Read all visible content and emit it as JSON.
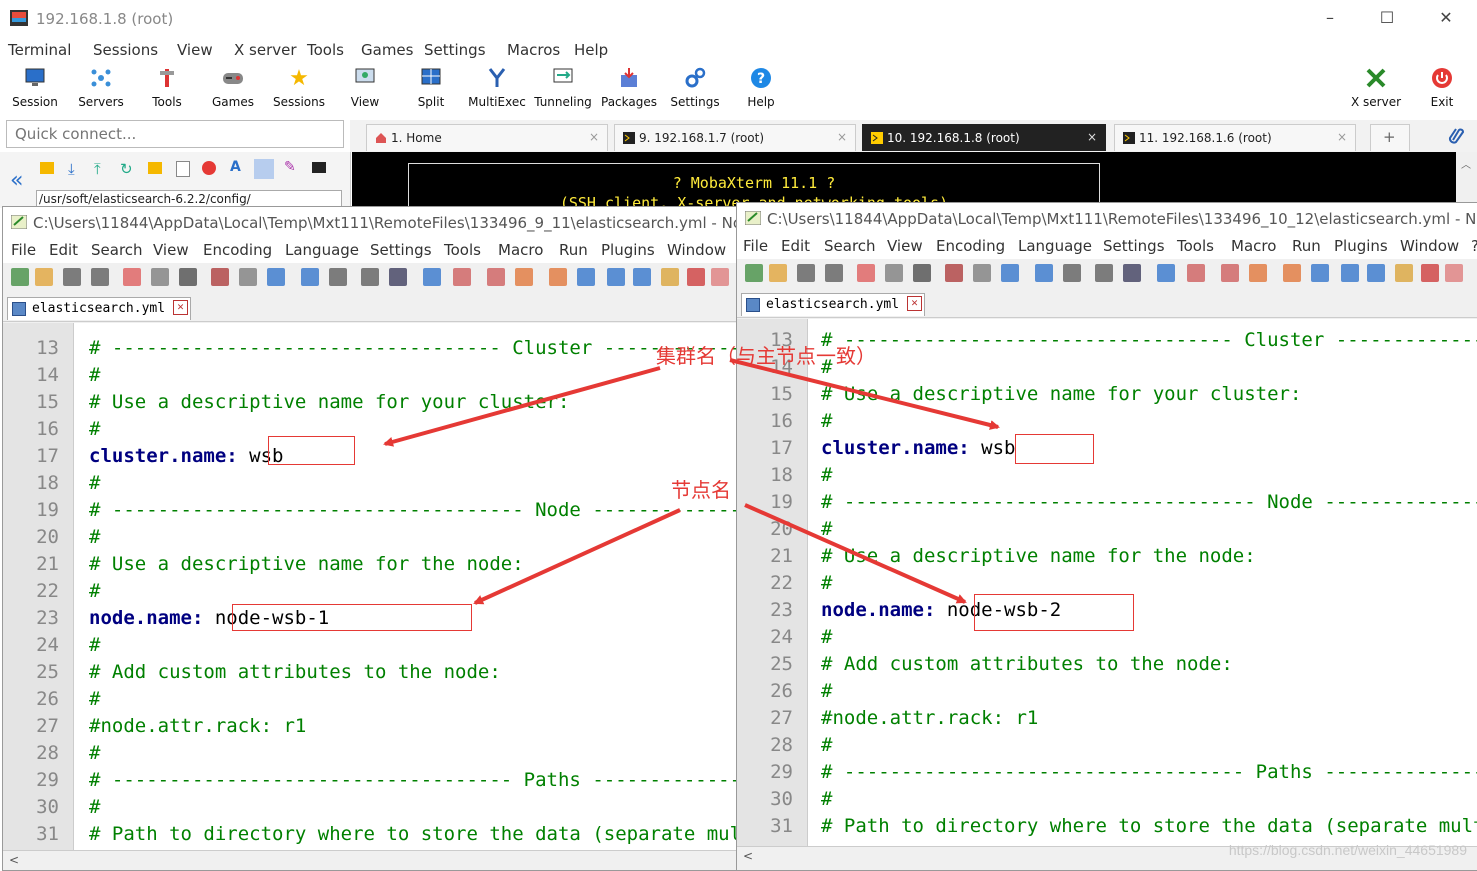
{
  "moba": {
    "title": "192.168.1.8 (root)",
    "menu": [
      "Terminal",
      "Sessions",
      "View",
      "X server",
      "Tools",
      "Games",
      "Settings",
      "Macros",
      "Help"
    ],
    "toolbar": [
      {
        "label": "Session",
        "icon": "monitor-icon"
      },
      {
        "label": "Servers",
        "icon": "servers-icon"
      },
      {
        "label": "Tools",
        "icon": "tools-icon"
      },
      {
        "label": "Games",
        "icon": "gamepad-icon"
      },
      {
        "label": "Sessions",
        "icon": "star-icon"
      },
      {
        "label": "View",
        "icon": "view-icon"
      },
      {
        "label": "Split",
        "icon": "split-icon"
      },
      {
        "label": "MultiExec",
        "icon": "fork-icon"
      },
      {
        "label": "Tunneling",
        "icon": "tunnel-icon"
      },
      {
        "label": "Packages",
        "icon": "package-icon"
      },
      {
        "label": "Settings",
        "icon": "gears-icon"
      },
      {
        "label": "Help",
        "icon": "help-icon"
      }
    ],
    "xserver_label": "X server",
    "exit_label": "Exit",
    "quick_connect_placeholder": "Quick connect...",
    "tabs": [
      {
        "label": "1. Home",
        "close": "×"
      },
      {
        "label": "9. 192.168.1.7 (root)",
        "close": "×"
      },
      {
        "label": "10. 192.168.1.8 (root)",
        "close": "×"
      },
      {
        "label": "11. 192.168.1.6 (root)",
        "close": "×"
      }
    ],
    "sidebar_path": "/usr/soft/elasticsearch-6.2.2/config/",
    "terminal_banner": "? MobaXterm 11.1 ?",
    "terminal_banner2": "(SSH client, X-server and networking tools)"
  },
  "left": {
    "title": "C:\\Users\\11844\\AppData\\Local\\Temp\\Mxt111\\RemoteFiles\\133496_9_11\\elasticsearch.yml - Notepad++",
    "menu": [
      "File",
      "Edit",
      "Search",
      "View",
      "Encoding",
      "Language",
      "Settings",
      "Tools",
      "Macro",
      "Run",
      "Plugins",
      "Window"
    ],
    "tab": "elasticsearch.yml",
    "lines": [
      {
        "n": "13",
        "c": "# ---------------------------------- Cluster -----------------------------------",
        "t": "cmt"
      },
      {
        "n": "14",
        "c": "#",
        "t": "cmt"
      },
      {
        "n": "15",
        "c": "# Use a descriptive name for your cluster:",
        "t": "cmt"
      },
      {
        "n": "16",
        "c": "#",
        "t": "cmt"
      },
      {
        "n": "17",
        "k": "cluster.name:",
        "v": " wsb",
        "t": "kv"
      },
      {
        "n": "18",
        "c": "#",
        "t": "cmt"
      },
      {
        "n": "19",
        "c": "# ------------------------------------ Node ------------------------------------",
        "t": "cmt"
      },
      {
        "n": "20",
        "c": "#",
        "t": "cmt"
      },
      {
        "n": "21",
        "c": "# Use a descriptive name for the node:",
        "t": "cmt"
      },
      {
        "n": "22",
        "c": "#",
        "t": "cmt"
      },
      {
        "n": "23",
        "k": "node.name:",
        "v": " node-wsb-1",
        "t": "kv"
      },
      {
        "n": "24",
        "c": "#",
        "t": "cmt"
      },
      {
        "n": "25",
        "c": "# Add custom attributes to the node:",
        "t": "cmt"
      },
      {
        "n": "26",
        "c": "#",
        "t": "cmt"
      },
      {
        "n": "27",
        "c": "#node.attr.rack: r1",
        "t": "cmt"
      },
      {
        "n": "28",
        "c": "#",
        "t": "cmt"
      },
      {
        "n": "29",
        "c": "# ----------------------------------- Paths ------------------------------------",
        "t": "cmt"
      },
      {
        "n": "30",
        "c": "#",
        "t": "cmt"
      },
      {
        "n": "31",
        "c": "# Path to directory where to store the data (separate multiple locations by comma):",
        "t": "cmt"
      }
    ]
  },
  "right": {
    "title": "C:\\Users\\11844\\AppData\\Local\\Temp\\Mxt111\\RemoteFiles\\133496_10_12\\elasticsearch.yml - Notepad++",
    "menu": [
      "File",
      "Edit",
      "Search",
      "View",
      "Encoding",
      "Language",
      "Settings",
      "Tools",
      "Macro",
      "Run",
      "Plugins",
      "Window",
      "?"
    ],
    "tab": "elasticsearch.yml",
    "lines": [
      {
        "n": "13",
        "c": "# ---------------------------------- Cluster -----------------------------------",
        "t": "cmt"
      },
      {
        "n": "14",
        "c": "#",
        "t": "cmt"
      },
      {
        "n": "15",
        "c": "# Use a descriptive name for your cluster:",
        "t": "cmt"
      },
      {
        "n": "16",
        "c": "#",
        "t": "cmt"
      },
      {
        "n": "17",
        "k": "cluster.name:",
        "v": " wsb",
        "t": "kv"
      },
      {
        "n": "18",
        "c": "#",
        "t": "cmt"
      },
      {
        "n": "19",
        "c": "# ------------------------------------ Node ------------------------------------",
        "t": "cmt"
      },
      {
        "n": "20",
        "c": "#",
        "t": "cmt"
      },
      {
        "n": "21",
        "c": "# Use a descriptive name for the node:",
        "t": "cmt"
      },
      {
        "n": "22",
        "c": "#",
        "t": "cmt"
      },
      {
        "n": "23",
        "k": "node.name:",
        "v": " node-wsb-2",
        "t": "kv"
      },
      {
        "n": "24",
        "c": "#",
        "t": "cmt"
      },
      {
        "n": "25",
        "c": "# Add custom attributes to the node:",
        "t": "cmt"
      },
      {
        "n": "26",
        "c": "#",
        "t": "cmt"
      },
      {
        "n": "27",
        "c": "#node.attr.rack: r1",
        "t": "cmt"
      },
      {
        "n": "28",
        "c": "#",
        "t": "cmt"
      },
      {
        "n": "29",
        "c": "# ----------------------------------- Paths ------------------------------------",
        "t": "cmt"
      },
      {
        "n": "30",
        "c": "#",
        "t": "cmt"
      },
      {
        "n": "31",
        "c": "# Path to directory where to store the data (separate multiple locations by comma):",
        "t": "cmt"
      }
    ]
  },
  "annotations": {
    "cluster_note": "集群名（与主节点一致）",
    "node_note": "节点名"
  },
  "watermark": "https://blog.csdn.net/weixin_44651989",
  "colors": {
    "accent_red": "#e53935",
    "comment": "#008000",
    "keyword": "#000080",
    "terminal_text": "#ffeb3b"
  }
}
